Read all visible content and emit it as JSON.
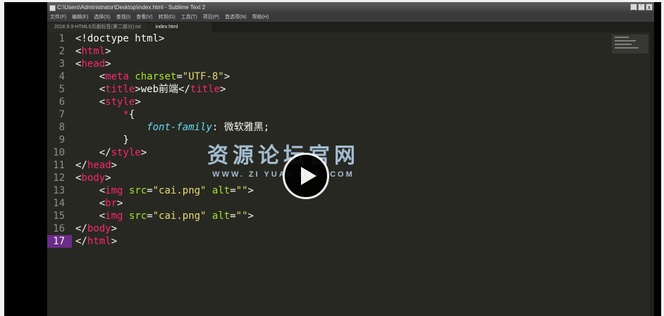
{
  "window": {
    "title": "C:\\Users\\Administrator\\Desktop\\index.html - Sublime Text 2",
    "buttons": [
      "_",
      "´",
      "x"
    ]
  },
  "menu": [
    "文件(F)",
    "编辑(E)",
    "选择(S)",
    "查找(I)",
    "查看(V)",
    "转到(G)",
    "工具(T)",
    "项目(P)",
    "首选项(N)",
    "帮助(H)"
  ],
  "tabs": [
    {
      "label": "2016.9.9-HTML5页面标签(第二部分).txt",
      "active": false
    },
    {
      "label": "index.html",
      "active": true
    }
  ],
  "editor": {
    "current_line": 17,
    "line_numbers": [
      "1",
      "2",
      "3",
      "4",
      "5",
      "6",
      "7",
      "8",
      "9",
      "10",
      "11",
      "12",
      "13",
      "14",
      "15",
      "16",
      "17"
    ]
  },
  "code": {
    "l1": "<!doctype html>",
    "l2_open": "<",
    "l2_tag": "html",
    "l2_close": ">",
    "l3_open": "<",
    "l3_tag": "head",
    "l3_close": ">",
    "l4_open": "<",
    "l4_tag": "meta",
    "l4_attr": "charset",
    "l4_eq": "=",
    "l4_val": "\"UTF-8\"",
    "l4_close": ">",
    "l5_open": "<",
    "l5_tag": "title",
    "l5_mid": ">web前端</",
    "l5_tag2": "title",
    "l5_close": ">",
    "l6_open": "<",
    "l6_tag": "style",
    "l6_close": ">",
    "l7_star": "*",
    "l7_brace": "{",
    "l8_prop": "font-family",
    "l8_rest": ": 微软雅黑;",
    "l9": "}",
    "l10_open": "</",
    "l10_tag": "style",
    "l10_close": ">",
    "l11_open": "</",
    "l11_tag": "head",
    "l11_close": ">",
    "l12_open": "<",
    "l12_tag": "body",
    "l12_close": ">",
    "l13_open": "<",
    "l13_tag": "img",
    "l13_attr1": "src",
    "l13_eq1": "=",
    "l13_val1": "\"cai.png\"",
    "l13_attr2": "alt",
    "l13_eq2": "=",
    "l13_val2": "\"\"",
    "l13_close": ">",
    "l14_open": "<",
    "l14_tag": "br",
    "l14_close": ">",
    "l15_open": "<",
    "l15_tag": "img",
    "l15_attr1": "src",
    "l15_eq1": "=",
    "l15_val1": "\"cai.png\"",
    "l15_attr2": "alt",
    "l15_eq2": "=",
    "l15_val2": "\"\"",
    "l15_close": ">",
    "l16_open": "</",
    "l16_tag": "body",
    "l16_close": ">",
    "l17_open": "</",
    "l17_tag": "html",
    "l17_close": ">"
  },
  "watermark": {
    "title": "资源论坛官网",
    "url": "WWW. ZI YUAN BBS .COM"
  },
  "colors": {
    "background": "#272822",
    "tag": "#f92672",
    "attribute": "#a6e22e",
    "string": "#e6db74",
    "property": "#66d9ef",
    "current_line_highlight": "#6b2c8a"
  },
  "icons": [
    "sublime-app-icon",
    "play-icon"
  ]
}
